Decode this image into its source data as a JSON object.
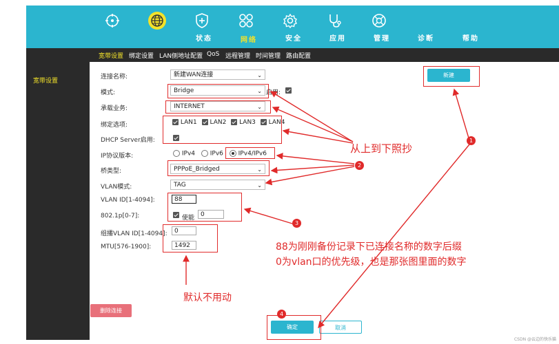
{
  "topnav": {
    "items": [
      {
        "label": "状态",
        "icon": "status-icon"
      },
      {
        "label": "网络",
        "icon": "globe-icon",
        "active": true
      },
      {
        "label": "安全",
        "icon": "shield-plus-icon"
      },
      {
        "label": "应用",
        "icon": "apps-icon"
      },
      {
        "label": "管理",
        "icon": "gear-icon"
      },
      {
        "label": "诊断",
        "icon": "stethoscope-icon"
      },
      {
        "label": "帮助",
        "icon": "help-icon"
      }
    ]
  },
  "subnav": {
    "items": [
      "宽带设置",
      "绑定设置",
      "LAN侧地址配置",
      "QoS",
      "远程管理",
      "时间管理",
      "路由配置"
    ]
  },
  "sidebar": {
    "item": "宽带设置"
  },
  "form": {
    "connection_name": {
      "label": "连接名称:",
      "value": "新建WAN连接"
    },
    "mode": {
      "label": "模式:",
      "value": "Bridge",
      "enable_label": "启用:"
    },
    "service": {
      "label": "承载业务:",
      "value": "INTERNET"
    },
    "bind": {
      "label": "绑定选项:",
      "options": [
        "LAN1",
        "LAN2",
        "LAN3",
        "LAN4"
      ]
    },
    "dhcp": {
      "label": "DHCP Server启用:"
    },
    "ip_version": {
      "label": "IP协议版本:",
      "options": [
        "IPv4",
        "IPv6",
        "IPv4/IPv6"
      ],
      "selected": "IPv4/IPv6"
    },
    "bridge_type": {
      "label": "桥类型:",
      "value": "PPPoE_Bridged"
    },
    "vlan_mode": {
      "label": "VLAN模式:",
      "value": "TAG"
    },
    "vlan_id": {
      "label": "VLAN ID[1-4094]:",
      "value": "88"
    },
    "dot1p": {
      "label": "802.1p[0-7]:",
      "enable_label": "使能",
      "value": "0"
    },
    "mcast_vlan": {
      "label": "组播VLAN ID[1-4094]:",
      "value": "0"
    },
    "mtu": {
      "label": "MTU[576-1900]:",
      "value": "1492"
    }
  },
  "buttons": {
    "new": "新建",
    "delete": "删除连接",
    "ok": "确定",
    "cancel": "取消"
  },
  "annotations": {
    "copy_note": "从上到下照抄",
    "vlan_note_line1": "88为刚刚备份记录下已连接名称的数字后缀",
    "vlan_note_line2": "0为vlan口的优先级，也是那张图里面的数字",
    "default_note": "默认不用动",
    "markers": [
      "1",
      "2",
      "3",
      "4"
    ]
  },
  "watermark": "CSDN @云边的快乐猫",
  "colors": {
    "topbar": "#2bb5cf",
    "accent_yellow": "#f2e22a",
    "annotation_red": "#e02a2a",
    "delete_button": "#e8707a"
  }
}
